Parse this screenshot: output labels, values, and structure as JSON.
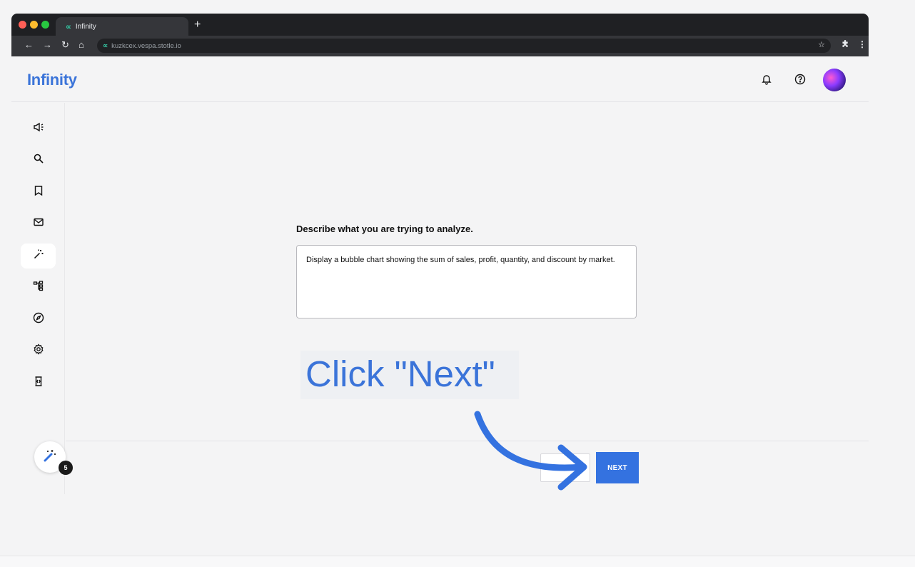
{
  "browser": {
    "tab_title": "Infinity",
    "new_tab_symbol": "+",
    "url": "kuzkcex.vespa.stotle.io"
  },
  "app": {
    "logo": "Infinity"
  },
  "sidebar": {
    "items": [
      {
        "icon": "megaphone-icon"
      },
      {
        "icon": "search-icon"
      },
      {
        "icon": "bookmark-icon"
      },
      {
        "icon": "mail-icon"
      },
      {
        "icon": "magic-wand-icon",
        "active": true
      },
      {
        "icon": "hierarchy-icon"
      },
      {
        "icon": "compass-icon"
      },
      {
        "icon": "gear-icon"
      },
      {
        "icon": "code-scroll-icon"
      }
    ]
  },
  "main": {
    "prompt_label": "Describe what you are trying to analyze.",
    "prompt_value": "Display a bubble chart showing the sum of sales, profit, quantity, and discount by market.",
    "next_label": "NEXT"
  },
  "magic": {
    "badge_count": "5"
  },
  "tutorial": {
    "callout": "Click \"Next\""
  },
  "colors": {
    "accent": "#3472e0",
    "logo": "#3b74d9"
  }
}
